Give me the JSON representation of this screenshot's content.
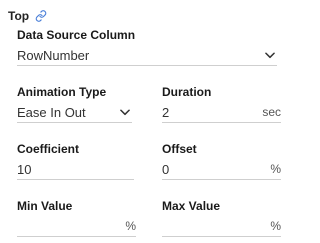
{
  "section": {
    "title": "Top",
    "link_icon": "link-icon"
  },
  "data_source_column": {
    "label": "Data Source Column",
    "value": "RowNumber",
    "icon": "chevron-down-icon"
  },
  "animation_type": {
    "label": "Animation Type",
    "value": "Ease In Out",
    "icon": "chevron-down-icon"
  },
  "duration": {
    "label": "Duration",
    "value": "2",
    "unit": "sec"
  },
  "coefficient": {
    "label": "Coefficient",
    "value": "10"
  },
  "offset": {
    "label": "Offset",
    "value": "0",
    "unit": "%"
  },
  "min_value": {
    "label": "Min Value",
    "value": "",
    "unit": "%"
  },
  "max_value": {
    "label": "Max Value",
    "value": "",
    "unit": "%"
  },
  "colors": {
    "link_icon": "#4a7fd8",
    "underline": "#cfcfcf",
    "label_text": "#1a1a1a"
  }
}
